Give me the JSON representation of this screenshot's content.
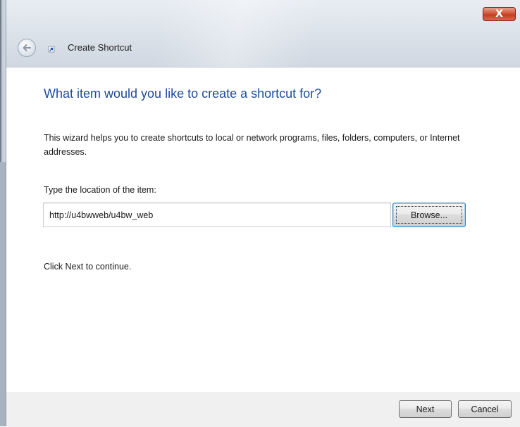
{
  "window": {
    "title": "Create Shortcut",
    "close_label": "X"
  },
  "wizard": {
    "heading": "What item would you like to create a shortcut for?",
    "description": "This wizard helps you to create shortcuts to local or network programs, files, folders, computers, or Internet addresses.",
    "location_label": "Type the location of the item:",
    "location_value": "http://u4bwweb/u4bw_web",
    "browse_label": "Browse...",
    "continue_text": "Click Next to continue."
  },
  "footer": {
    "next_label": "Next",
    "cancel_label": "Cancel"
  },
  "colors": {
    "heading": "#1e4a9b",
    "close_button": "#c43d22"
  },
  "icons": {
    "back": "back-arrow-icon",
    "shortcut": "shortcut-arrow-icon",
    "close": "close-icon"
  }
}
